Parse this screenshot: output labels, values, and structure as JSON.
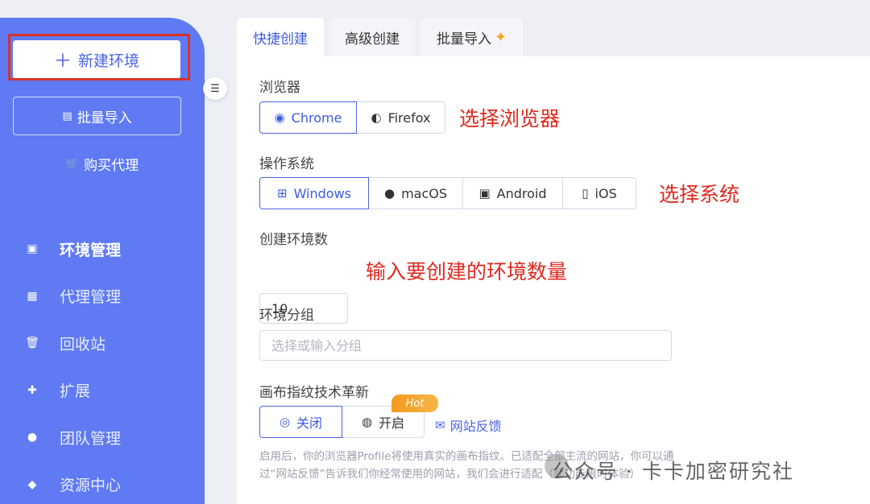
{
  "sidebar": {
    "new_env": "新建环境",
    "batch_import": "批量导入",
    "buy_proxy": "购买代理",
    "items": [
      {
        "label": "环境管理",
        "icon": "monitor-icon",
        "active": true
      },
      {
        "label": "代理管理",
        "icon": "server-icon"
      },
      {
        "label": "回收站",
        "icon": "trash-icon"
      },
      {
        "label": "扩展",
        "icon": "puzzle-icon"
      },
      {
        "label": "团队管理",
        "icon": "team-icon"
      },
      {
        "label": "资源中心",
        "icon": "cube-icon"
      }
    ]
  },
  "tabs": [
    {
      "label": "快捷创建",
      "active": true
    },
    {
      "label": "高级创建"
    },
    {
      "label": "批量导入"
    }
  ],
  "form": {
    "browser_label": "浏览器",
    "browsers": [
      "Chrome",
      "Firefox"
    ],
    "browser_selected": "Chrome",
    "os_label": "操作系统",
    "os_options": [
      "Windows",
      "macOS",
      "Android",
      "iOS"
    ],
    "os_selected": "Windows",
    "count_label": "创建环境数",
    "count_value": "10",
    "group_label": "环境分组",
    "group_placeholder": "选择或输入分组",
    "canvas_label": "画布指纹技术革新",
    "canvas_off": "关闭",
    "canvas_on": "开启",
    "hot_badge": "Hot",
    "feedback": "网站反馈",
    "desc_line1": "启用后，你的浏览器Profile将使用真实的画布指纹。已适配全部主流的网站，你可以通",
    "desc_line2": "过“网站反馈”告诉我们你经常使用的网站，我们会进行适配（此功能限时体验）"
  },
  "annotations": {
    "browser": "选择浏览器",
    "os": "选择系统",
    "count": "输入要创建的环境数量"
  },
  "watermark": "公众号 · 卡卡加密研究社",
  "colors": {
    "sidebar": "#5f7af2",
    "accent": "#3c5be0",
    "annotation": "#e0291f",
    "hot": "#f39a1c"
  }
}
